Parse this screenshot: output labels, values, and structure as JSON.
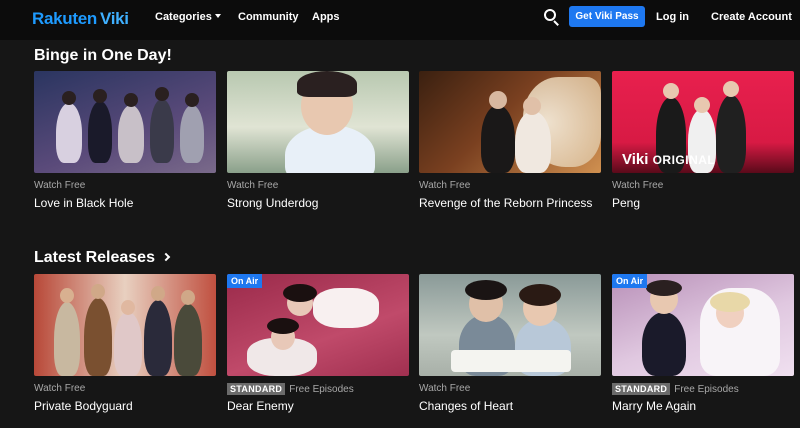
{
  "header": {
    "logo_brand": "Rakuten",
    "logo_product": "Viki",
    "nav": [
      "Categories",
      "Community",
      "Apps"
    ],
    "cta_label": "Get Viki Pass",
    "login_label": "Log in",
    "create_account_label": "Create Account"
  },
  "sections": [
    {
      "title": "Binge in One Day!",
      "cards": [
        {
          "meta": "Watch Free",
          "title": "Love in Black Hole",
          "palette": [
            "#3a4a7a",
            "#6a5a8a"
          ]
        },
        {
          "meta": "Watch Free",
          "title": "Strong Underdog",
          "palette": [
            "#a9b8a3",
            "#d8dccb"
          ]
        },
        {
          "meta": "Watch Free",
          "title": "Revenge of the Reborn Princess",
          "palette": [
            "#6b3a1f",
            "#c8793a"
          ]
        },
        {
          "meta": "Watch Free",
          "title": "Peng",
          "palette": [
            "#d41f4a",
            "#f04870"
          ],
          "watermark_top": "Viki",
          "watermark_bottom": "ORIGINAL"
        }
      ]
    },
    {
      "title": "Latest Releases",
      "cards": [
        {
          "meta": "Watch Free",
          "title": "Private Bodyguard",
          "palette": [
            "#c05040",
            "#e5c5b5"
          ]
        },
        {
          "badge": "On Air",
          "tier": "STANDARD",
          "meta": "Free Episodes",
          "title": "Dear Enemy",
          "palette": [
            "#8a2a4a",
            "#c04a6a"
          ]
        },
        {
          "meta": "Watch Free",
          "title": "Changes of Heart",
          "palette": [
            "#7a8a8a",
            "#b8c0b8"
          ]
        },
        {
          "badge": "On Air",
          "tier": "STANDARD",
          "meta": "Free Episodes",
          "title": "Marry Me Again",
          "palette": [
            "#c8a0c0",
            "#e8d0e0"
          ]
        }
      ]
    }
  ]
}
